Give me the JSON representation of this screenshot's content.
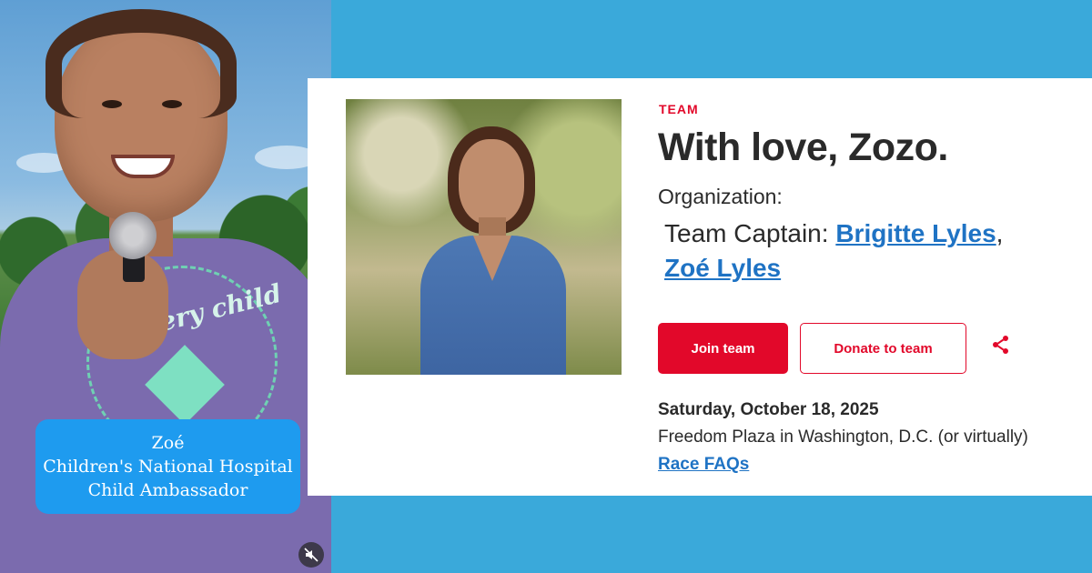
{
  "video": {
    "caption": {
      "name": "Zoé",
      "line2": "Children's National Hospital",
      "line3": "Child Ambassador"
    },
    "shirt_text": "every child",
    "mute_icon": "muted-speaker-icon"
  },
  "team_card": {
    "eyebrow": "TEAM",
    "title": "With love, Zozo.",
    "organization_label": "Organization:",
    "captain_prefix": "Team Captain:",
    "captains": [
      "Brigitte Lyles",
      "Zoé Lyles"
    ],
    "captain_separator": ",",
    "buttons": {
      "join": "Join team",
      "donate": "Donate to team"
    },
    "share_icon": "share-icon",
    "event": {
      "date": "Saturday, October 18, 2025",
      "location": "Freedom Plaza in Washington, D.C. (or virtually)",
      "faq_link": "Race FAQs"
    }
  },
  "colors": {
    "background": "#3aa9da",
    "accent_red": "#e2082a",
    "link_blue": "#1f73c4",
    "caption_blue": "#1e9bef"
  }
}
